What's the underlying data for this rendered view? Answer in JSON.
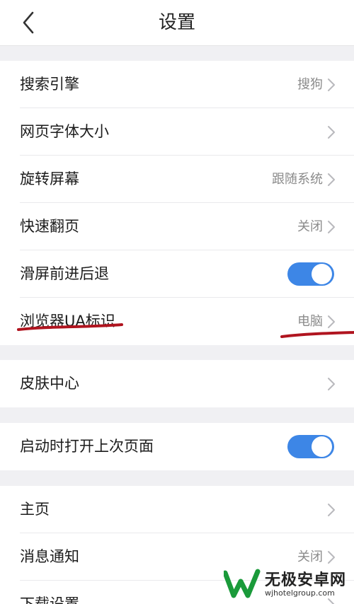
{
  "header": {
    "title": "设置"
  },
  "groups": [
    {
      "items": [
        {
          "label": "搜索引擎",
          "value": "搜狗"
        },
        {
          "label": "网页字体大小",
          "value": ""
        },
        {
          "label": "旋转屏幕",
          "value": "跟随系统"
        },
        {
          "label": "快速翻页",
          "value": "关闭"
        },
        {
          "label": "滑屏前进后退",
          "toggle": "on"
        },
        {
          "label": "浏览器UA标识",
          "value": "电脑"
        }
      ]
    },
    {
      "items": [
        {
          "label": "皮肤中心",
          "value": ""
        }
      ]
    },
    {
      "items": [
        {
          "label": "启动时打开上次页面",
          "toggle": "on"
        }
      ]
    },
    {
      "items": [
        {
          "label": "主页",
          "value": ""
        },
        {
          "label": "消息通知",
          "value": "关闭"
        },
        {
          "label": "下载设置",
          "value": ""
        }
      ]
    }
  ],
  "colors": {
    "toggle_on": "#3d86e6",
    "annotation": "#b0141f",
    "background": "#f0f0f3"
  },
  "watermark": {
    "name": "无极安卓网",
    "url": "wjhotelgroup.com"
  }
}
